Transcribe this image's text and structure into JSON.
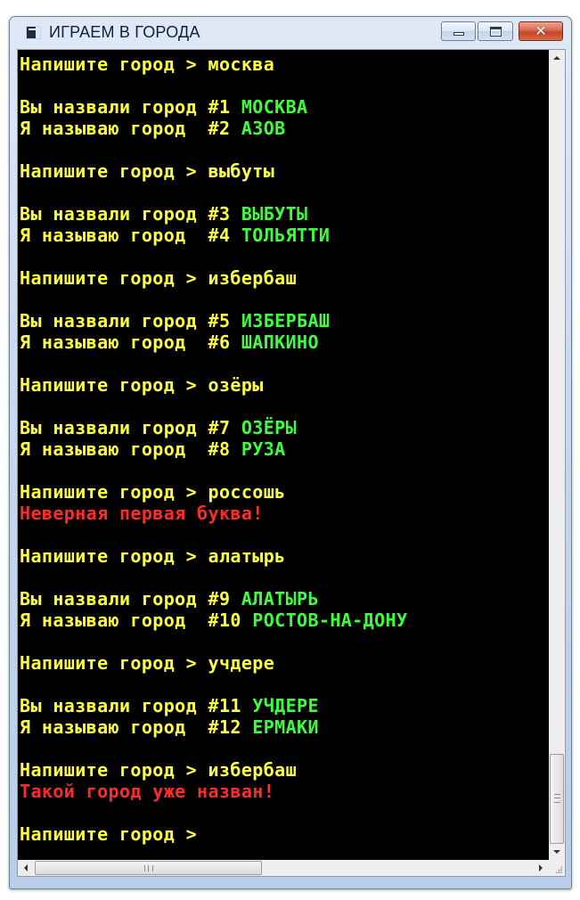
{
  "window": {
    "title": "ИГРАЕМ В ГОРОДА"
  },
  "controls": {
    "minimize": "minimize",
    "maximize": "maximize",
    "close": "✕"
  },
  "console": {
    "colors": {
      "prompt": "#ffff3d",
      "city": "#3cff3c",
      "error": "#ff2a2a",
      "background": "#000000"
    },
    "lines": [
      {
        "text": "Напишите город > москва",
        "color": "yellow"
      },
      {
        "text": "",
        "color": "yellow"
      },
      {
        "text": "Вы назвали город #1 ",
        "color": "yellow",
        "city": "МОСКВА"
      },
      {
        "text": "Я называю город  #2 ",
        "color": "yellow",
        "city": "АЗОВ"
      },
      {
        "text": "",
        "color": "yellow"
      },
      {
        "text": "Напишите город > выбуты",
        "color": "yellow"
      },
      {
        "text": "",
        "color": "yellow"
      },
      {
        "text": "Вы назвали город #3 ",
        "color": "yellow",
        "city": "ВЫБУТЫ"
      },
      {
        "text": "Я называю город  #4 ",
        "color": "yellow",
        "city": "ТОЛЬЯТТИ"
      },
      {
        "text": "",
        "color": "yellow"
      },
      {
        "text": "Напишите город > избербаш",
        "color": "yellow"
      },
      {
        "text": "",
        "color": "yellow"
      },
      {
        "text": "Вы назвали город #5 ",
        "color": "yellow",
        "city": "ИЗБЕРБАШ"
      },
      {
        "text": "Я называю город  #6 ",
        "color": "yellow",
        "city": "ШАПКИНО"
      },
      {
        "text": "",
        "color": "yellow"
      },
      {
        "text": "Напишите город > озёры",
        "color": "yellow"
      },
      {
        "text": "",
        "color": "yellow"
      },
      {
        "text": "Вы назвали город #7 ",
        "color": "yellow",
        "city": "ОЗЁРЫ"
      },
      {
        "text": "Я называю город  #8 ",
        "color": "yellow",
        "city": "РУЗА"
      },
      {
        "text": "",
        "color": "yellow"
      },
      {
        "text": "Напишите город > россошь",
        "color": "yellow"
      },
      {
        "text": "Неверная первая буква!",
        "color": "red"
      },
      {
        "text": "",
        "color": "yellow"
      },
      {
        "text": "Напишите город > алатырь",
        "color": "yellow"
      },
      {
        "text": "",
        "color": "yellow"
      },
      {
        "text": "Вы назвали город #9 ",
        "color": "yellow",
        "city": "АЛАТЫРЬ"
      },
      {
        "text": "Я называю город  #10 ",
        "color": "yellow",
        "city": "РОСТОВ-НА-ДОНУ"
      },
      {
        "text": "",
        "color": "yellow"
      },
      {
        "text": "Напишите город > учдере",
        "color": "yellow"
      },
      {
        "text": "",
        "color": "yellow"
      },
      {
        "text": "Вы назвали город #11 ",
        "color": "yellow",
        "city": "УЧДЕРЕ"
      },
      {
        "text": "Я называю город  #12 ",
        "color": "yellow",
        "city": "ЕРМАКИ"
      },
      {
        "text": "",
        "color": "yellow"
      },
      {
        "text": "Напишите город > избербаш",
        "color": "yellow"
      },
      {
        "text": "Такой город уже назван!",
        "color": "red"
      },
      {
        "text": "",
        "color": "yellow"
      },
      {
        "text": "Напишите город >",
        "color": "yellow"
      }
    ]
  },
  "scrollbars": {
    "hthumb_grip": "III"
  }
}
